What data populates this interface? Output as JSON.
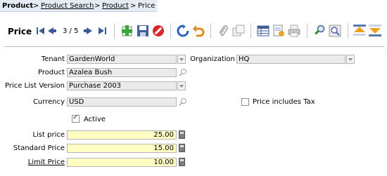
{
  "breadcrumb": {
    "root": "Product",
    "separator": ">",
    "items": [
      "Product Search",
      "Product",
      "Price"
    ]
  },
  "toolbar": {
    "title": "Price",
    "record_nav": "3 / 5",
    "icons": [
      "first-record-icon",
      "previous-record-icon",
      "next-record-icon",
      "last-record-icon",
      "new-record-icon",
      "save-icon",
      "delete-icon",
      "refresh-icon",
      "undo-icon",
      "attachment-icon",
      "copy-icon",
      "grid-toggle-icon",
      "report-icon",
      "print-icon",
      "find-icon",
      "zoom-icon",
      "parent-record-icon",
      "detail-record-icon"
    ]
  },
  "form": {
    "tenant": {
      "label": "Tenant",
      "value": "GardenWorld"
    },
    "organization": {
      "label": "Organization",
      "value": "HQ"
    },
    "product": {
      "label": "Product",
      "value": "Azalea Bush"
    },
    "price_list_version": {
      "label": "Price List Version",
      "value": "Purchase 2003"
    },
    "currency": {
      "label": "Currency",
      "value": "USD"
    },
    "price_includes_tax": {
      "label": "Price includes Tax",
      "checked": false
    },
    "active": {
      "label": "Active",
      "checked": true
    },
    "list_price": {
      "label": "List price",
      "value": "25.00"
    },
    "standard_price": {
      "label": "Standard Price",
      "value": "15.00"
    },
    "limit_price": {
      "label": "Limit Price",
      "value": "10.00"
    }
  },
  "colors": {
    "breadcrumb_tab": "#e6ecf6",
    "readonly_field": "#ebebeb",
    "mandatory_field": "#ffffc4"
  }
}
